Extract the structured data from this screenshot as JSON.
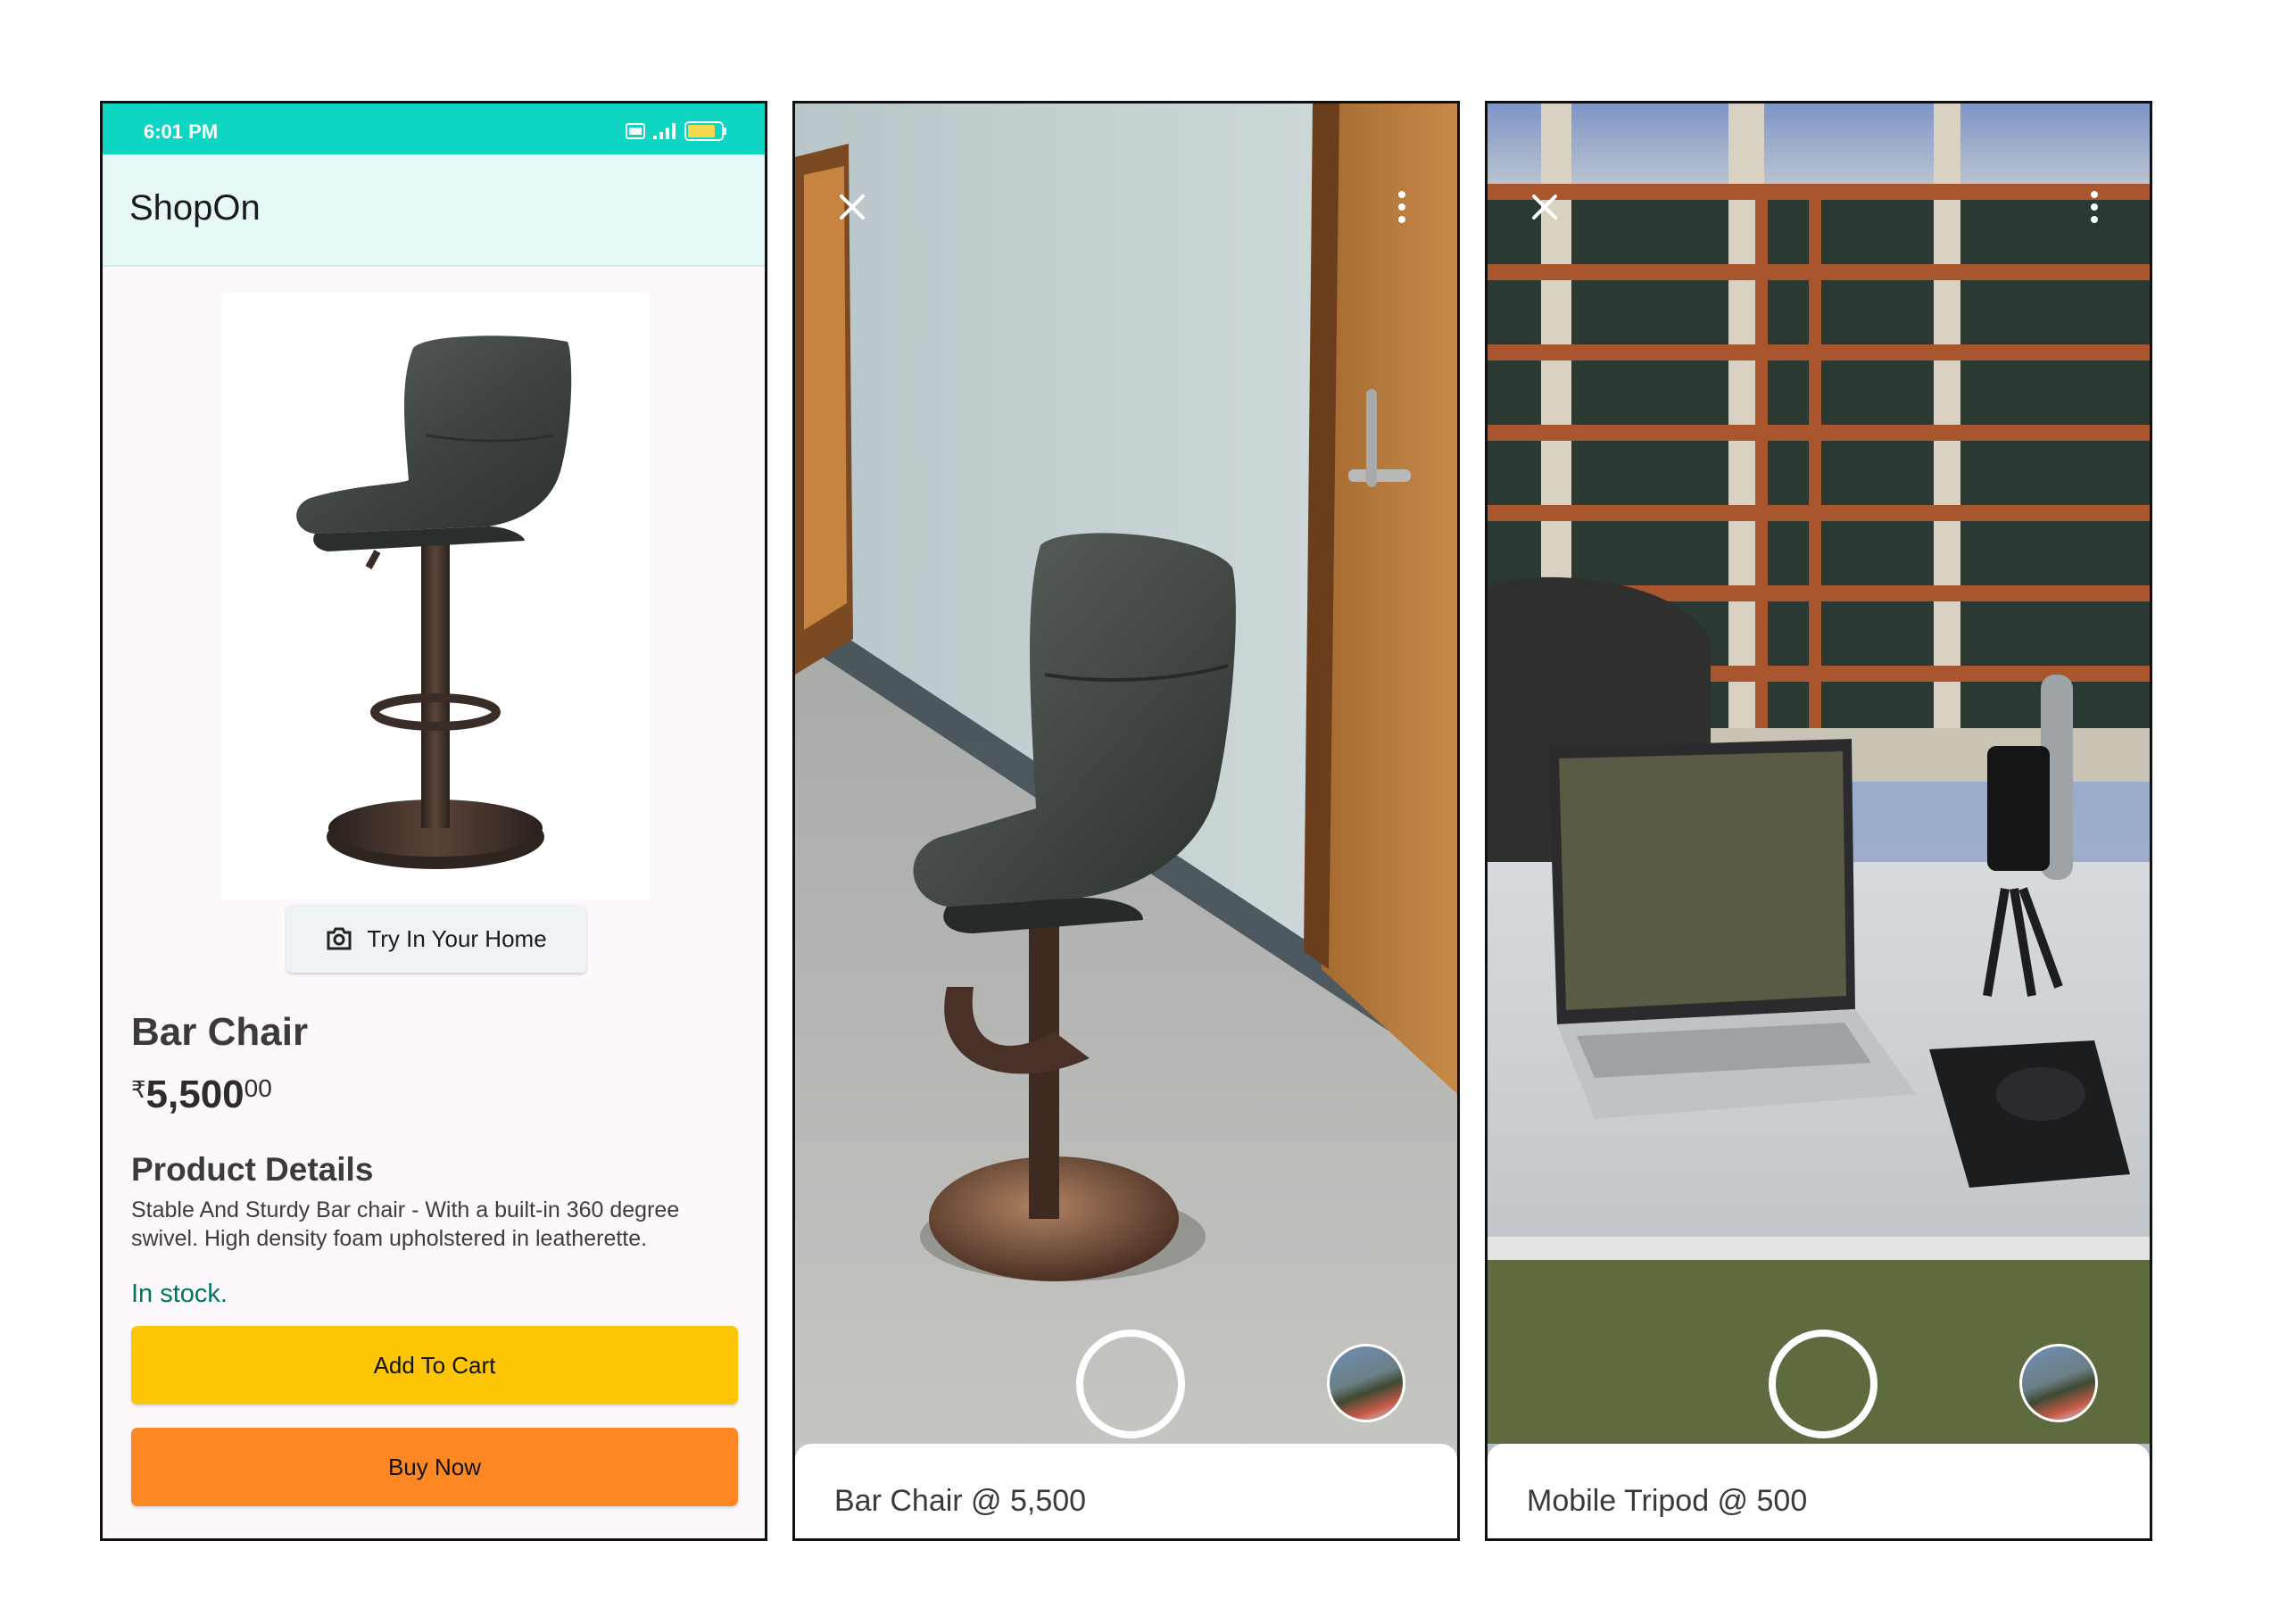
{
  "shop_screen": {
    "status_time": "6:01 PM",
    "app_title": "ShopOn",
    "try_button": "Try In Your Home",
    "product_name": "Bar Chair",
    "price": {
      "currency": "₹",
      "whole": "5,500",
      "fraction": "00"
    },
    "details_heading": "Product Details",
    "details_text": "Stable And Sturdy Bar chair - With a built-in 360 degree swivel. High density foam upholstered in leatherette.",
    "stock_status": "In stock.",
    "add_to_cart": "Add To Cart",
    "buy_now": "Buy Now",
    "icons": [
      "volte-icon",
      "signal-icon",
      "battery-icon",
      "camera-icon"
    ],
    "colors": {
      "status_bar": "#0fd6c2",
      "app_bar": "#e6f7f7",
      "add_to_cart": "#fcc506",
      "buy_now": "#fd8723",
      "in_stock": "#007560"
    }
  },
  "ar_chair": {
    "label": "Bar Chair @ 5,500",
    "icons": [
      "close-icon",
      "more-icon",
      "shutter-button",
      "gallery-thumbnail"
    ]
  },
  "ar_tripod": {
    "label": "Mobile Tripod @ 500",
    "icons": [
      "close-icon",
      "more-icon",
      "shutter-button",
      "gallery-thumbnail"
    ]
  }
}
